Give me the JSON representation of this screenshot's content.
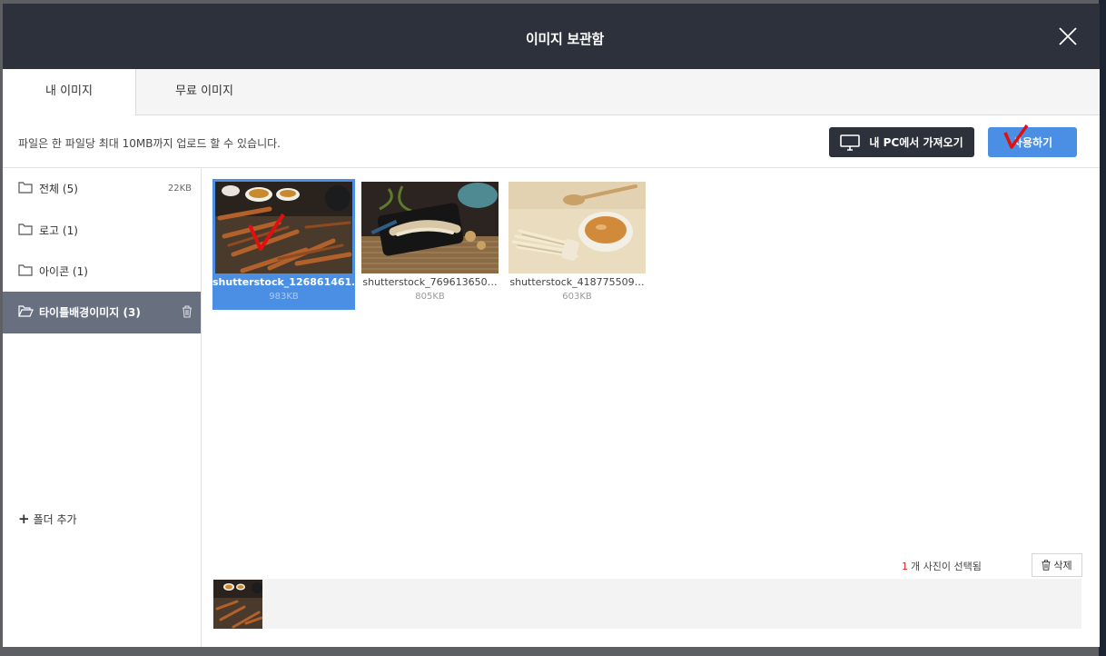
{
  "dialog": {
    "title": "이미지 보관함"
  },
  "tabs": [
    {
      "label": "내 이미지"
    },
    {
      "label": "무료 이미지"
    }
  ],
  "toolbar": {
    "notice": "파일은 한 파일당 최대 10MB까지 업로드 할 수 있습니다.",
    "upload_label": "내 PC에서 가져오기",
    "use_label": "사용하기"
  },
  "folders": [
    {
      "label": "전체 (5)",
      "size": "22KB"
    },
    {
      "label": "로고 (1)"
    },
    {
      "label": "아이콘 (1)"
    },
    {
      "label": "타이틀배경이미지 (3)",
      "selected": true
    }
  ],
  "add_folder_label": "폴더 추가",
  "images": [
    {
      "name": "shutterstock_126861461…",
      "size": "983KB",
      "selected": true
    },
    {
      "name": "shutterstock_769613650…",
      "size": "805KB"
    },
    {
      "name": "shutterstock_418775509…",
      "size": "603KB"
    }
  ],
  "selection": {
    "count": "1",
    "text": "개 사진이 선택됨",
    "delete_label": "삭제"
  },
  "icons": [
    "close-icon",
    "monitor-icon",
    "folder-icon",
    "folder-open-icon",
    "trash-icon",
    "plus-icon",
    "check-mark-annotation"
  ],
  "colors": {
    "header": "#2c313b",
    "accent": "#4a8fe3",
    "folder_active": "#687080",
    "annotation": "#e01010"
  }
}
